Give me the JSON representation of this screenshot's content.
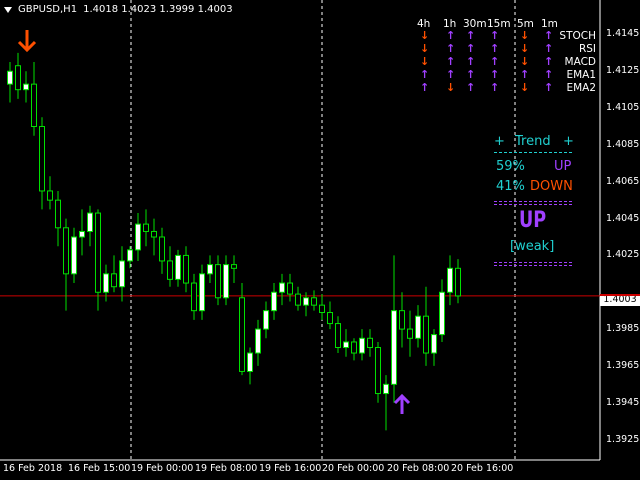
{
  "header": {
    "symbol": "GBPUSD,H1",
    "ohlc": "1.4018 1.4023 1.3999 1.4003"
  },
  "price_axis": {
    "ticks": [
      "1.4145",
      "1.4125",
      "1.4105",
      "1.4085",
      "1.4065",
      "1.4045",
      "1.4025",
      "1.4003",
      "1.3985",
      "1.3965",
      "1.3945",
      "1.3925"
    ],
    "current_price": "1.4003"
  },
  "time_axis": {
    "labels": [
      "16 Feb 2018",
      "16 Feb 15:00",
      "19 Feb 00:00",
      "19 Feb 08:00",
      "19 Feb 16:00",
      "20 Feb 00:00",
      "20 Feb 08:00",
      "20 Feb 16:00"
    ]
  },
  "timeframes": [
    "4h",
    "1h",
    "30m",
    "15m",
    "5m",
    "1m"
  ],
  "indicators": [
    {
      "name": "STOCH",
      "dirs": [
        "down",
        "up",
        "up",
        "up",
        "down",
        "up"
      ]
    },
    {
      "name": "RSI",
      "dirs": [
        "down",
        "up",
        "up",
        "up",
        "down",
        "up"
      ]
    },
    {
      "name": "MACD",
      "dirs": [
        "down",
        "up",
        "up",
        "up",
        "down",
        "up"
      ]
    },
    {
      "name": "EMA1",
      "dirs": [
        "up",
        "up",
        "up",
        "up",
        "up",
        "up"
      ]
    },
    {
      "name": "EMA2",
      "dirs": [
        "up",
        "down",
        "up",
        "up",
        "down",
        "up"
      ]
    }
  ],
  "trend_panel": {
    "plus_left": "+",
    "title": "Trend",
    "plus_right": "+",
    "up_pct": "59%",
    "up_label": "UP",
    "down_pct": "41%",
    "down_label": "DOWN",
    "signal": "UP",
    "strength": "[weak]"
  },
  "colors": {
    "bull_fill": "#ffffff",
    "bear_fill": "#000000",
    "wick": "#00e000",
    "price_line": "#cc0000",
    "up_arrow": "#a040ff",
    "down_arrow": "#ff5000",
    "cyan": "#20d0d0",
    "purple": "#a040ff",
    "orange": "#ff5000"
  },
  "chart_data": {
    "type": "candlestick",
    "ylim": [
      1.3915,
      1.4155
    ],
    "candles": [
      {
        "o": 1.4118,
        "h": 1.413,
        "l": 1.4108,
        "c": 1.4125
      },
      {
        "o": 1.4128,
        "h": 1.4135,
        "l": 1.411,
        "c": 1.4115
      },
      {
        "o": 1.4115,
        "h": 1.4125,
        "l": 1.4108,
        "c": 1.4118
      },
      {
        "o": 1.4118,
        "h": 1.413,
        "l": 1.409,
        "c": 1.4095
      },
      {
        "o": 1.4095,
        "h": 1.41,
        "l": 1.405,
        "c": 1.406
      },
      {
        "o": 1.406,
        "h": 1.4068,
        "l": 1.405,
        "c": 1.4055
      },
      {
        "o": 1.4055,
        "h": 1.406,
        "l": 1.403,
        "c": 1.404
      },
      {
        "o": 1.404,
        "h": 1.4045,
        "l": 1.3995,
        "c": 1.4015
      },
      {
        "o": 1.4015,
        "h": 1.404,
        "l": 1.401,
        "c": 1.4035
      },
      {
        "o": 1.4035,
        "h": 1.405,
        "l": 1.4025,
        "c": 1.4038
      },
      {
        "o": 1.4038,
        "h": 1.4052,
        "l": 1.403,
        "c": 1.4048
      },
      {
        "o": 1.4048,
        "h": 1.405,
        "l": 1.3995,
        "c": 1.4005
      },
      {
        "o": 1.4005,
        "h": 1.402,
        "l": 1.4,
        "c": 1.4015
      },
      {
        "o": 1.4015,
        "h": 1.4025,
        "l": 1.4005,
        "c": 1.4008
      },
      {
        "o": 1.4008,
        "h": 1.403,
        "l": 1.4,
        "c": 1.4022
      },
      {
        "o": 1.4022,
        "h": 1.403,
        "l": 1.4018,
        "c": 1.4028
      },
      {
        "o": 1.4028,
        "h": 1.4048,
        "l": 1.4022,
        "c": 1.4042
      },
      {
        "o": 1.4042,
        "h": 1.405,
        "l": 1.403,
        "c": 1.4038
      },
      {
        "o": 1.4038,
        "h": 1.4045,
        "l": 1.4025,
        "c": 1.4035
      },
      {
        "o": 1.4035,
        "h": 1.404,
        "l": 1.4015,
        "c": 1.4022
      },
      {
        "o": 1.4022,
        "h": 1.403,
        "l": 1.4008,
        "c": 1.4012
      },
      {
        "o": 1.4012,
        "h": 1.4028,
        "l": 1.4008,
        "c": 1.4025
      },
      {
        "o": 1.4025,
        "h": 1.403,
        "l": 1.4005,
        "c": 1.401
      },
      {
        "o": 1.401,
        "h": 1.4015,
        "l": 1.399,
        "c": 1.3995
      },
      {
        "o": 1.3995,
        "h": 1.402,
        "l": 1.399,
        "c": 1.4015
      },
      {
        "o": 1.4015,
        "h": 1.4025,
        "l": 1.401,
        "c": 1.402
      },
      {
        "o": 1.402,
        "h": 1.4025,
        "l": 1.3998,
        "c": 1.4002
      },
      {
        "o": 1.4002,
        "h": 1.4025,
        "l": 1.3998,
        "c": 1.402
      },
      {
        "o": 1.402,
        "h": 1.4025,
        "l": 1.401,
        "c": 1.4018
      },
      {
        "o": 1.4002,
        "h": 1.401,
        "l": 1.396,
        "c": 1.3962
      },
      {
        "o": 1.3962,
        "h": 1.3975,
        "l": 1.3955,
        "c": 1.3972
      },
      {
        "o": 1.3972,
        "h": 1.399,
        "l": 1.3965,
        "c": 1.3985
      },
      {
        "o": 1.3985,
        "h": 1.4,
        "l": 1.398,
        "c": 1.3995
      },
      {
        "o": 1.3995,
        "h": 1.401,
        "l": 1.399,
        "c": 1.4005
      },
      {
        "o": 1.4005,
        "h": 1.4015,
        "l": 1.3998,
        "c": 1.401
      },
      {
        "o": 1.401,
        "h": 1.4015,
        "l": 1.4,
        "c": 1.4004
      },
      {
        "o": 1.4004,
        "h": 1.4008,
        "l": 1.3995,
        "c": 1.3998
      },
      {
        "o": 1.3998,
        "h": 1.4005,
        "l": 1.3992,
        "c": 1.4002
      },
      {
        "o": 1.4002,
        "h": 1.4006,
        "l": 1.3995,
        "c": 1.3998
      },
      {
        "o": 1.3998,
        "h": 1.4004,
        "l": 1.399,
        "c": 1.3994
      },
      {
        "o": 1.3994,
        "h": 1.4,
        "l": 1.3985,
        "c": 1.3988
      },
      {
        "o": 1.3988,
        "h": 1.3992,
        "l": 1.3972,
        "c": 1.3975
      },
      {
        "o": 1.3975,
        "h": 1.3985,
        "l": 1.397,
        "c": 1.3978
      },
      {
        "o": 1.3978,
        "h": 1.398,
        "l": 1.3968,
        "c": 1.3972
      },
      {
        "o": 1.3972,
        "h": 1.3985,
        "l": 1.3968,
        "c": 1.398
      },
      {
        "o": 1.398,
        "h": 1.3985,
        "l": 1.397,
        "c": 1.3975
      },
      {
        "o": 1.3975,
        "h": 1.3978,
        "l": 1.3945,
        "c": 1.395
      },
      {
        "o": 1.395,
        "h": 1.396,
        "l": 1.393,
        "c": 1.3955
      },
      {
        "o": 1.3955,
        "h": 1.4025,
        "l": 1.3945,
        "c": 1.3995
      },
      {
        "o": 1.3995,
        "h": 1.4005,
        "l": 1.3975,
        "c": 1.3985
      },
      {
        "o": 1.3985,
        "h": 1.3995,
        "l": 1.397,
        "c": 1.398
      },
      {
        "o": 1.398,
        "h": 1.3998,
        "l": 1.3975,
        "c": 1.3992
      },
      {
        "o": 1.3992,
        "h": 1.4008,
        "l": 1.3965,
        "c": 1.3972
      },
      {
        "o": 1.3972,
        "h": 1.3985,
        "l": 1.3965,
        "c": 1.3982
      },
      {
        "o": 1.3982,
        "h": 1.4012,
        "l": 1.3978,
        "c": 1.4005
      },
      {
        "o": 1.4005,
        "h": 1.4025,
        "l": 1.3998,
        "c": 1.4018
      },
      {
        "o": 1.4018,
        "h": 1.4023,
        "l": 1.3999,
        "c": 1.4003
      }
    ]
  }
}
